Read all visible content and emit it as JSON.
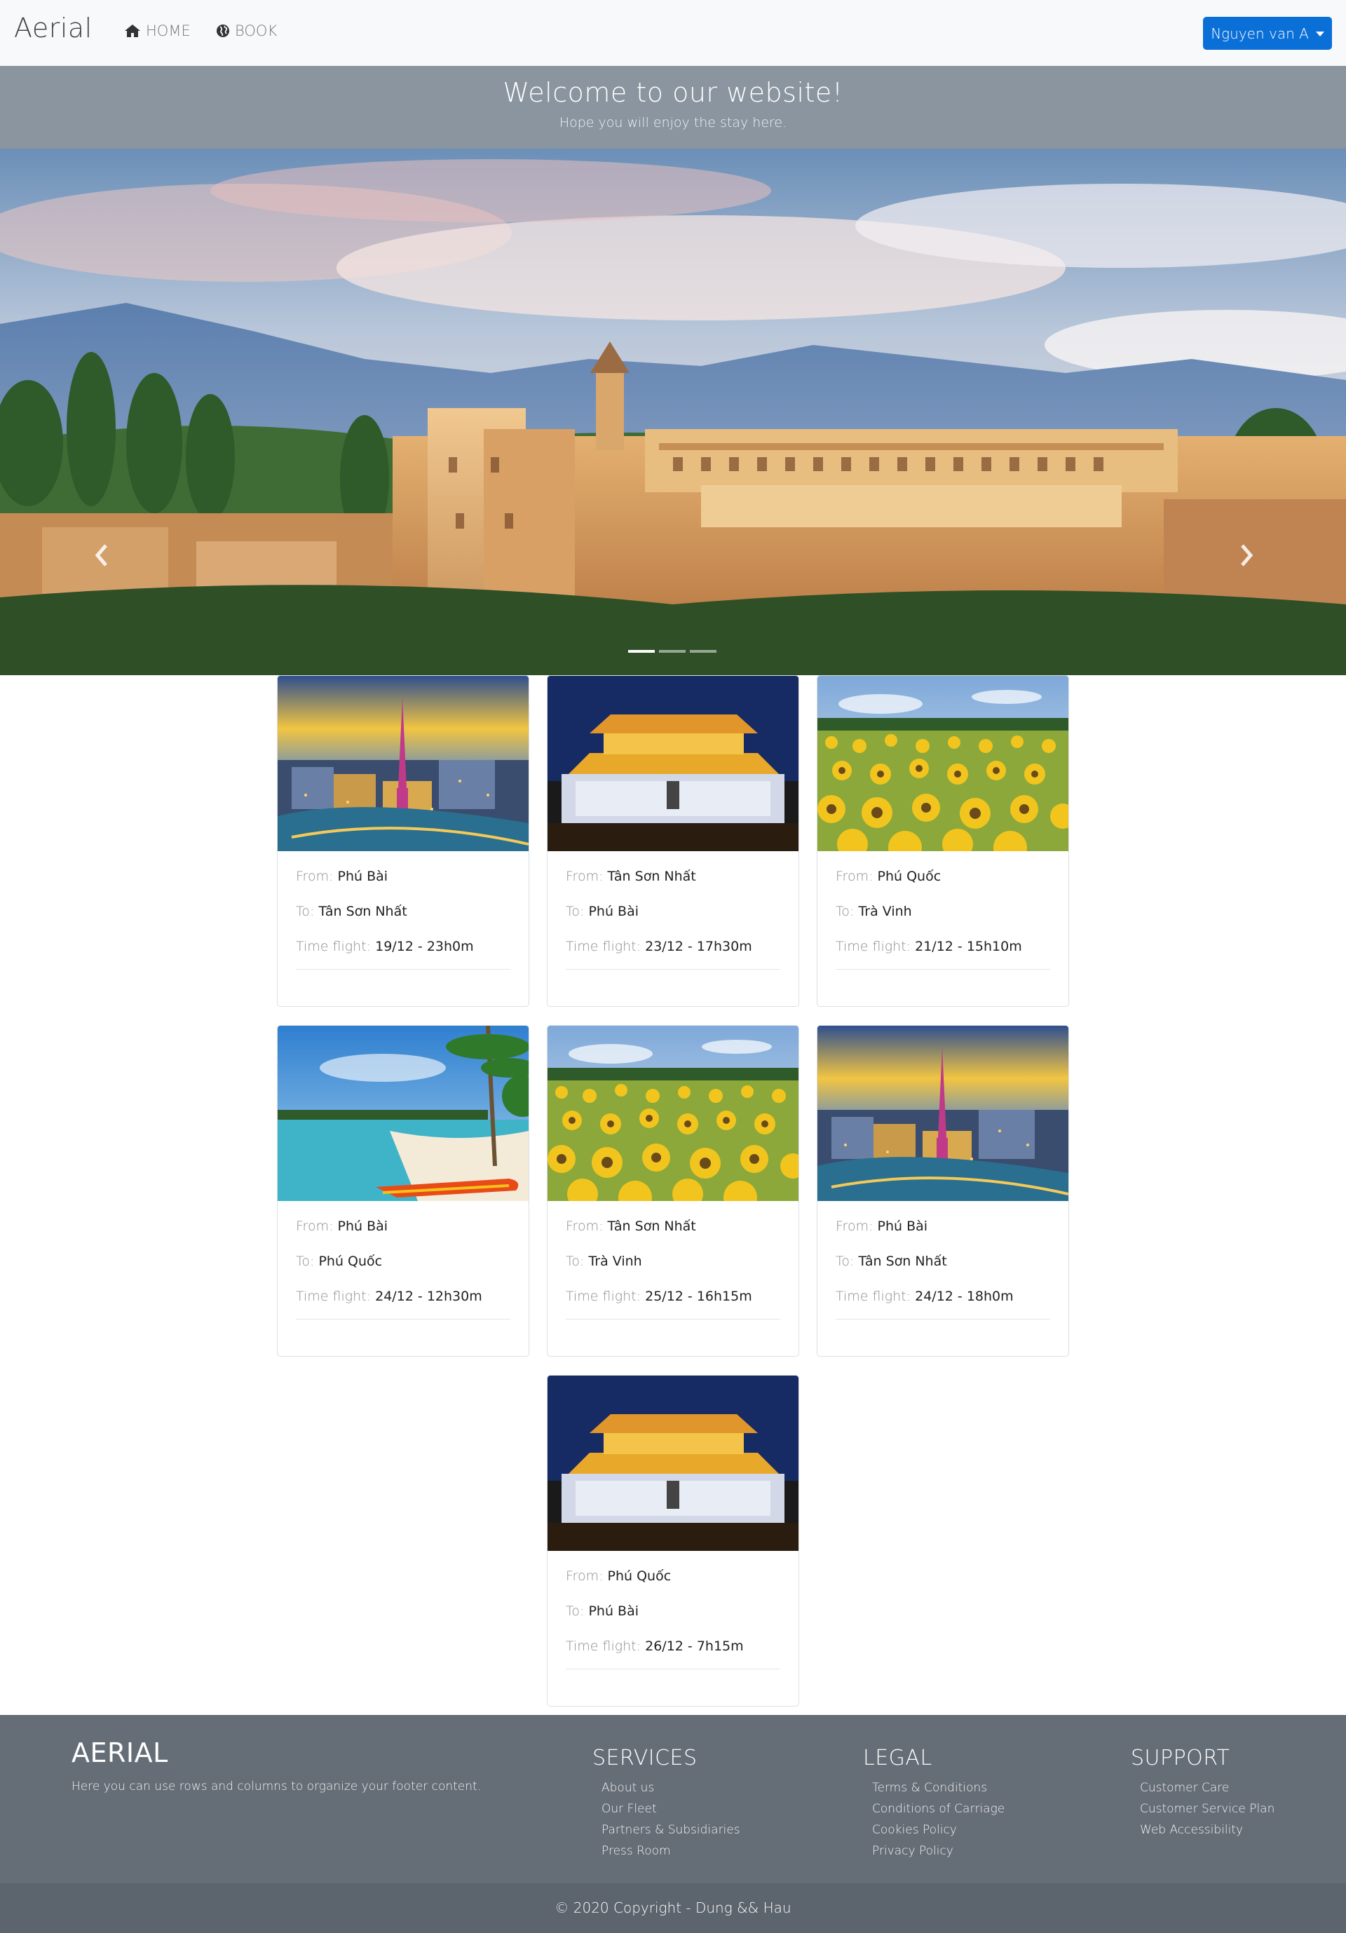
{
  "navbar": {
    "brand": "Aerial",
    "home_label": "HOME",
    "book_label": "BOOK",
    "user_label": "Nguyen van A"
  },
  "welcome": {
    "title": "Welcome to our website!",
    "subtitle": "Hope you will enjoy the stay here."
  },
  "carousel": {
    "slide_count": 3,
    "active_slide": 1
  },
  "flights": [
    {
      "image": "city-tower-night",
      "from_label": "From: ",
      "from": "Phú Bài",
      "to_label": "To: ",
      "to": "Tân Sơn Nhất",
      "time_label": "Time flight: ",
      "time": "19/12 - 23h0m"
    },
    {
      "image": "imperial-gate-night",
      "from_label": "From: ",
      "from": "Tân Sơn Nhất",
      "to_label": "To: ",
      "to": "Phú Bài",
      "time_label": "Time flight: ",
      "time": "23/12 - 17h30m"
    },
    {
      "image": "sunflower-field",
      "from_label": "From: ",
      "from": "Phú Quốc",
      "to_label": "To: ",
      "to": "Trà Vinh",
      "time_label": "Time flight: ",
      "time": "21/12 - 15h10m"
    },
    {
      "image": "tropical-beach",
      "from_label": "From: ",
      "from": "Phú Bài",
      "to_label": "To: ",
      "to": "Phú Quốc",
      "time_label": "Time flight: ",
      "time": "24/12 - 12h30m"
    },
    {
      "image": "sunflower-field",
      "from_label": "From: ",
      "from": "Tân Sơn Nhất",
      "to_label": "To: ",
      "to": "Trà Vinh",
      "time_label": "Time flight: ",
      "time": "25/12 - 16h15m"
    },
    {
      "image": "city-tower-night",
      "from_label": "From: ",
      "from": "Phú Bài",
      "to_label": "To: ",
      "to": "Tân Sơn Nhất",
      "time_label": "Time flight: ",
      "time": "24/12 - 18h0m"
    },
    {
      "image": "imperial-gate-night",
      "from_label": "From: ",
      "from": "Phú Quốc",
      "to_label": "To: ",
      "to": "Phú Bài",
      "time_label": "Time flight: ",
      "time": "26/12 - 7h15m"
    }
  ],
  "footer": {
    "brand": "AERIAL",
    "description": "Here you can use rows and columns to organize your footer content.",
    "services": {
      "title": "SERVICES",
      "items": [
        "About us",
        "Our Fleet",
        "Partners & Subsidiaries",
        "Press Room"
      ]
    },
    "legal": {
      "title": "LEGAL",
      "items": [
        "Terms & Conditions",
        "Conditions of Carriage",
        "Cookies Policy",
        "Privacy Policy"
      ]
    },
    "support": {
      "title": "SUPPORT",
      "items": [
        "Customer Care",
        "Customer Service Plan",
        "Web Accessibility"
      ]
    },
    "copyright": "© 2020 Copyright - Dung && Hau"
  },
  "colors": {
    "primary": "#0b6fd8",
    "navbar_bg": "#f8f9fa",
    "welcome_bg": "#8a959f",
    "footer_bg": "#656d76",
    "copyright_bg": "#5c646d"
  }
}
